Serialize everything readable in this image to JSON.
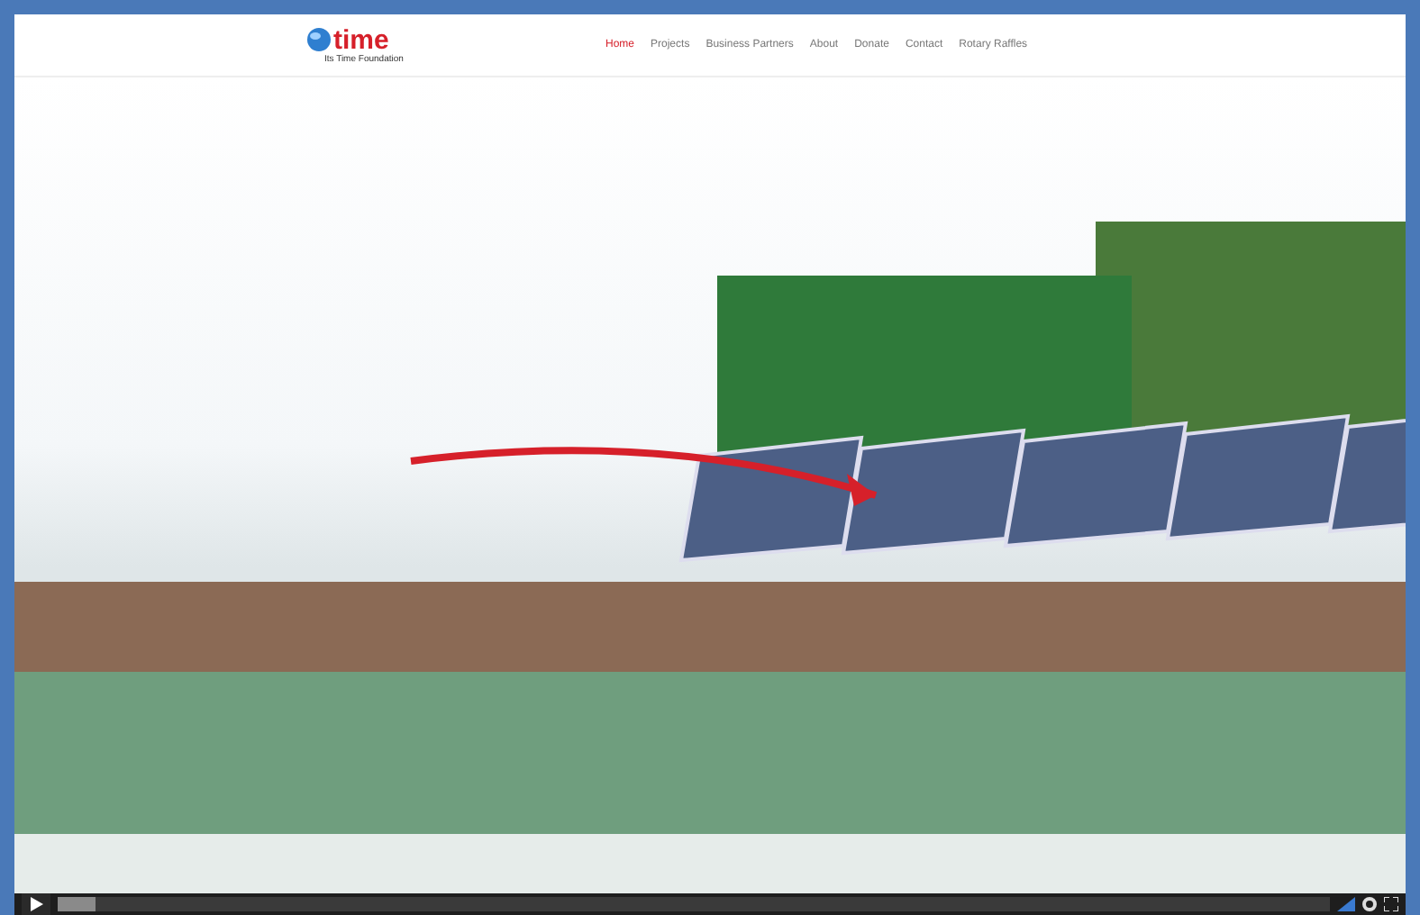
{
  "logo": {
    "name": "time",
    "tagline": "Its Time Foundation"
  },
  "nav": [
    {
      "label": "Home",
      "selected": true
    },
    {
      "label": "Projects",
      "selected": false
    },
    {
      "label": "Business Partners",
      "selected": false
    },
    {
      "label": "About",
      "selected": false
    },
    {
      "label": "Donate",
      "selected": false
    },
    {
      "label": "Contact",
      "selected": false
    },
    {
      "label": "Rotary Raffles",
      "selected": false
    }
  ],
  "video": {
    "level": 0.03
  }
}
